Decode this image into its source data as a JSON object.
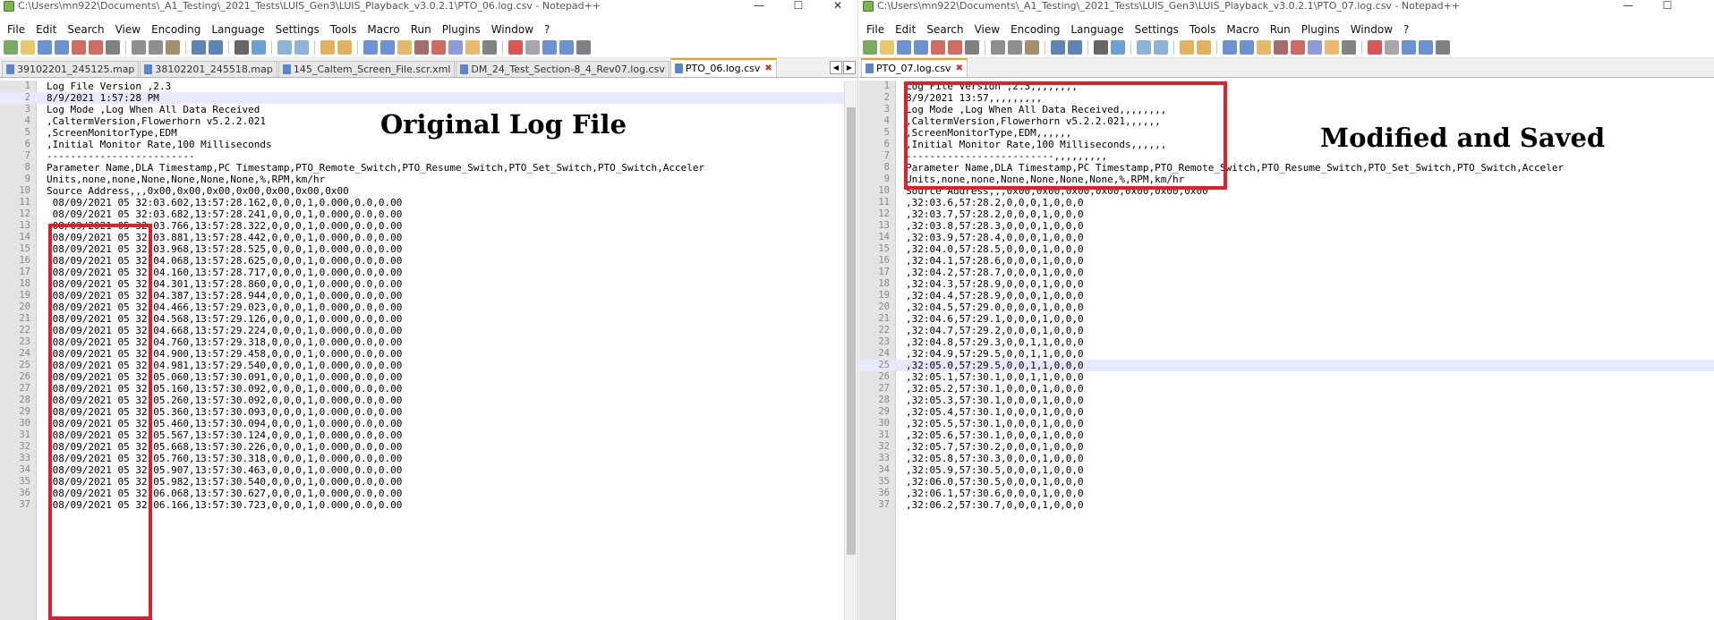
{
  "left": {
    "window_title": "C:\\Users\\mn922\\Documents\\_A1_Testing\\_2021_Tests\\LUIS_Gen3\\LUIS_Playback_v3.0.2.1\\PTO_06.log.csv - Notepad++",
    "window_controls": {
      "minimize": "—",
      "maximize": "☐",
      "close": "✕"
    },
    "menu": [
      "File",
      "Edit",
      "Search",
      "View",
      "Encoding",
      "Language",
      "Settings",
      "Tools",
      "Macro",
      "Run",
      "Plugins",
      "Window",
      "?"
    ],
    "tabs": [
      "39102201_245125.map",
      "38102201_245518.map",
      "145_Caltem_Screen_File.scr.xml",
      "DM_24_Test_Section-8_4_Rev07.log.csv",
      "PTO_06.log.csv"
    ],
    "active_tab": "PTO_06.log.csv",
    "tab_close_glyph": "✖",
    "tabnav": [
      "◀",
      "▶"
    ],
    "lines": [
      {
        "n": "1",
        "text": "Log File Version ,2.3"
      },
      {
        "n": "2",
        "text": "8/9/2021 1:57:28 PM"
      },
      {
        "n": "3",
        "text": "Log Mode ,Log When All Data Received"
      },
      {
        "n": "4",
        "text": ",CaltermVersion,Flowerhorn v5.2.2.021"
      },
      {
        "n": "5",
        "text": ",ScreenMonitorType,EDM"
      },
      {
        "n": "6",
        "text": ",Initial Monitor Rate,100 Milliseconds"
      },
      {
        "n": "7",
        "text": "-------------------------"
      },
      {
        "n": "8",
        "text": "Parameter Name,DLA Timestamp,PC Timestamp,PTO_Remote_Switch,PTO_Resume_Switch,PTO_Set_Switch,PTO_Switch,Acceler"
      },
      {
        "n": "9",
        "text": "Units,none,none,None,None,None,None,%,RPM,km/hr"
      },
      {
        "n": "10",
        "text": "Source Address,,,0x00,0x00,0x00,0x00,0x00,0x00,0x00"
      },
      {
        "n": "11",
        "text": " 08/09/2021 05 32:03.602,13:57:28.162,0,0,0,1,0.000,0.0,0.00"
      },
      {
        "n": "12",
        "text": " 08/09/2021 05 32:03.682,13:57:28.241,0,0,0,1,0.000,0.0,0.00"
      },
      {
        "n": "13",
        "text": " 08/09/2021 05 32:03.766,13:57:28.322,0,0,0,1,0.000,0.0,0.00"
      },
      {
        "n": "14",
        "text": " 08/09/2021 05 32:03.881,13:57:28.442,0,0,0,1,0.000,0.0,0.00"
      },
      {
        "n": "15",
        "text": " 08/09/2021 05 32:03.968,13:57:28.525,0,0,0,1,0.000,0.0,0.00"
      },
      {
        "n": "16",
        "text": " 08/09/2021 05 32:04.068,13:57:28.625,0,0,0,1,0.000,0.0,0.00"
      },
      {
        "n": "17",
        "text": " 08/09/2021 05 32:04.160,13:57:28.717,0,0,0,1,0.000,0.0,0.00"
      },
      {
        "n": "18",
        "text": " 08/09/2021 05 32:04.301,13:57:28.860,0,0,0,1,0.000,0.0,0.00"
      },
      {
        "n": "19",
        "text": " 08/09/2021 05 32:04.387,13:57:28.944,0,0,0,1,0.000,0.0,0.00"
      },
      {
        "n": "20",
        "text": " 08/09/2021 05 32:04.466,13:57:29.023,0,0,0,1,0.000,0.0,0.00"
      },
      {
        "n": "21",
        "text": " 08/09/2021 05 32:04.568,13:57:29.126,0,0,0,1,0.000,0.0,0.00"
      },
      {
        "n": "22",
        "text": " 08/09/2021 05 32:04.668,13:57:29.224,0,0,0,1,0.000,0.0,0.00"
      },
      {
        "n": "23",
        "text": " 08/09/2021 05 32:04.760,13:57:29.318,0,0,0,1,0.000,0.0,0.00"
      },
      {
        "n": "24",
        "text": " 08/09/2021 05 32:04.900,13:57:29.458,0,0,0,1,0.000,0.0,0.00"
      },
      {
        "n": "25",
        "text": " 08/09/2021 05 32:04.981,13:57:29.540,0,0,0,1,0.000,0.0,0.00"
      },
      {
        "n": "26",
        "text": " 08/09/2021 05 32:05.060,13:57:30.091,0,0,0,1,0.000,0.0,0.00"
      },
      {
        "n": "27",
        "text": " 08/09/2021 05 32:05.160,13:57:30.092,0,0,0,1,0.000,0.0,0.00"
      },
      {
        "n": "28",
        "text": " 08/09/2021 05 32:05.260,13:57:30.092,0,0,0,1,0.000,0.0,0.00"
      },
      {
        "n": "29",
        "text": " 08/09/2021 05 32:05.360,13:57:30.093,0,0,0,1,0.000,0.0,0.00"
      },
      {
        "n": "30",
        "text": " 08/09/2021 05 32:05.460,13:57:30.094,0,0,0,1,0.000,0.0,0.00"
      },
      {
        "n": "31",
        "text": " 08/09/2021 05 32:05.567,13:57:30.124,0,0,0,1,0.000,0.0,0.00"
      },
      {
        "n": "32",
        "text": " 08/09/2021 05 32:05.668,13:57:30.226,0,0,0,1,0.000,0.0,0.00"
      },
      {
        "n": "33",
        "text": " 08/09/2021 05 32:05.760,13:57:30.318,0,0,0,1,0.000,0.0,0.00"
      },
      {
        "n": "34",
        "text": " 08/09/2021 05 32:05.907,13:57:30.463,0,0,0,1,0.000,0.0,0.00"
      },
      {
        "n": "35",
        "text": " 08/09/2021 05 32:05.982,13:57:30.540,0,0,0,1,0.000,0.0,0.00"
      },
      {
        "n": "36",
        "text": " 08/09/2021 05 32:06.068,13:57:30.627,0,0,0,1,0.000,0.0,0.00"
      },
      {
        "n": "37",
        "text": " 08/09/2021 05 32:06.166,13:57:30.723,0,0,0,1,0.000,0.0,0.00"
      }
    ],
    "annotation": "Original Log File",
    "highlight_color": "#e0202a"
  },
  "right": {
    "window_title": "C:\\Users\\mn922\\Documents\\_A1_Testing\\_2021_Tests\\LUIS_Gen3\\LUIS_Playback_v3.0.2.1\\PTO_07.log.csv - Notepad++",
    "window_controls": {
      "minimize": "—",
      "maximize": "☐"
    },
    "menu": [
      "File",
      "Edit",
      "Search",
      "View",
      "Encoding",
      "Language",
      "Settings",
      "Tools",
      "Macro",
      "Run",
      "Plugins",
      "Window",
      "?"
    ],
    "tabs": [
      "PTO_07.log.csv"
    ],
    "active_tab": "PTO_07.log.csv",
    "tab_close_glyph": "✖",
    "lines": [
      {
        "n": "1",
        "text": "Log File Version ,2.3,,,,,,,,"
      },
      {
        "n": "2",
        "text": "8/9/2021 13:57,,,,,,,,,"
      },
      {
        "n": "3",
        "text": "Log Mode ,Log When All Data Received,,,,,,,,"
      },
      {
        "n": "4",
        "text": ",CaltermVersion,Flowerhorn v5.2.2.021,,,,,,"
      },
      {
        "n": "5",
        "text": ",ScreenMonitorType,EDM,,,,,,"
      },
      {
        "n": "6",
        "text": ",Initial Monitor Rate,100 Milliseconds,,,,,,"
      },
      {
        "n": "7",
        "text": "-------------------------,,,,,,,,,"
      },
      {
        "n": "8",
        "text": "Parameter Name,DLA Timestamp,PC Timestamp,PTO_Remote_Switch,PTO_Resume_Switch,PTO_Set_Switch,PTO_Switch,Acceler"
      },
      {
        "n": "9",
        "text": "Units,none,none,None,None,None,None,%,RPM,km/hr"
      },
      {
        "n": "10",
        "text": "Source Address,,,0x00,0x00,0x00,0x00,0x00,0x00,0x00"
      },
      {
        "n": "11",
        "text": ",32:03.6,57:28.2,0,0,0,1,0,0,0"
      },
      {
        "n": "12",
        "text": ",32:03.7,57:28.2,0,0,0,1,0,0,0"
      },
      {
        "n": "13",
        "text": ",32:03.8,57:28.3,0,0,0,1,0,0,0"
      },
      {
        "n": "14",
        "text": ",32:03.9,57:28.4,0,0,0,1,0,0,0"
      },
      {
        "n": "15",
        "text": ",32:04.0,57:28.5,0,0,0,1,0,0,0"
      },
      {
        "n": "16",
        "text": ",32:04.1,57:28.6,0,0,0,1,0,0,0"
      },
      {
        "n": "17",
        "text": ",32:04.2,57:28.7,0,0,0,1,0,0,0"
      },
      {
        "n": "18",
        "text": ",32:04.3,57:28.9,0,0,0,1,0,0,0"
      },
      {
        "n": "19",
        "text": ",32:04.4,57:28.9,0,0,0,1,0,0,0"
      },
      {
        "n": "20",
        "text": ",32:04.5,57:29.0,0,0,0,1,0,0,0"
      },
      {
        "n": "21",
        "text": ",32:04.6,57:29.1,0,0,0,1,0,0,0"
      },
      {
        "n": "22",
        "text": ",32:04.7,57:29.2,0,0,0,1,0,0,0"
      },
      {
        "n": "23",
        "text": ",32:04.8,57:29.3,0,0,1,1,0,0,0"
      },
      {
        "n": "24",
        "text": ",32:04.9,57:29.5,0,0,1,1,0,0,0"
      },
      {
        "n": "25",
        "text": ",32:05.0,57:29.5,0,0,1,1,0,0,0"
      },
      {
        "n": "26",
        "text": ",32:05.1,57:30.1,0,0,1,1,0,0,0"
      },
      {
        "n": "27",
        "text": ",32:05.2,57:30.1,0,0,0,1,0,0,0"
      },
      {
        "n": "28",
        "text": ",32:05.3,57:30.1,0,0,0,1,0,0,0"
      },
      {
        "n": "29",
        "text": ",32:05.4,57:30.1,0,0,0,1,0,0,0"
      },
      {
        "n": "30",
        "text": ",32:05.5,57:30.1,0,0,0,1,0,0,0"
      },
      {
        "n": "31",
        "text": ",32:05.6,57:30.1,0,0,0,1,0,0,0"
      },
      {
        "n": "32",
        "text": ",32:05.7,57:30.2,0,0,0,1,0,0,0"
      },
      {
        "n": "33",
        "text": ",32:05.8,57:30.3,0,0,0,1,0,0,0"
      },
      {
        "n": "34",
        "text": ",32:05.9,57:30.5,0,0,0,1,0,0,0"
      },
      {
        "n": "35",
        "text": ",32:06.0,57:30.5,0,0,0,1,0,0,0"
      },
      {
        "n": "36",
        "text": ",32:06.1,57:30.6,0,0,0,1,0,0,0"
      },
      {
        "n": "37",
        "text": ",32:06.2,57:30.7,0,0,0,1,0,0,0"
      }
    ],
    "annotation": "Modified and Saved",
    "highlight_color": "#e0202a"
  },
  "toolbar_icons": [
    "new",
    "open",
    "save",
    "save-all",
    "close",
    "close-all",
    "print",
    "cut",
    "copy",
    "paste",
    "undo",
    "redo",
    "find",
    "replace",
    "zoom-in",
    "zoom-out",
    "sync-v",
    "sync-h",
    "wrap",
    "all-chars",
    "indent-guide",
    "udl",
    "doc-map",
    "func-list",
    "folder-ws",
    "monitor",
    "record",
    "stop",
    "play",
    "play-multi",
    "save-macro"
  ]
}
